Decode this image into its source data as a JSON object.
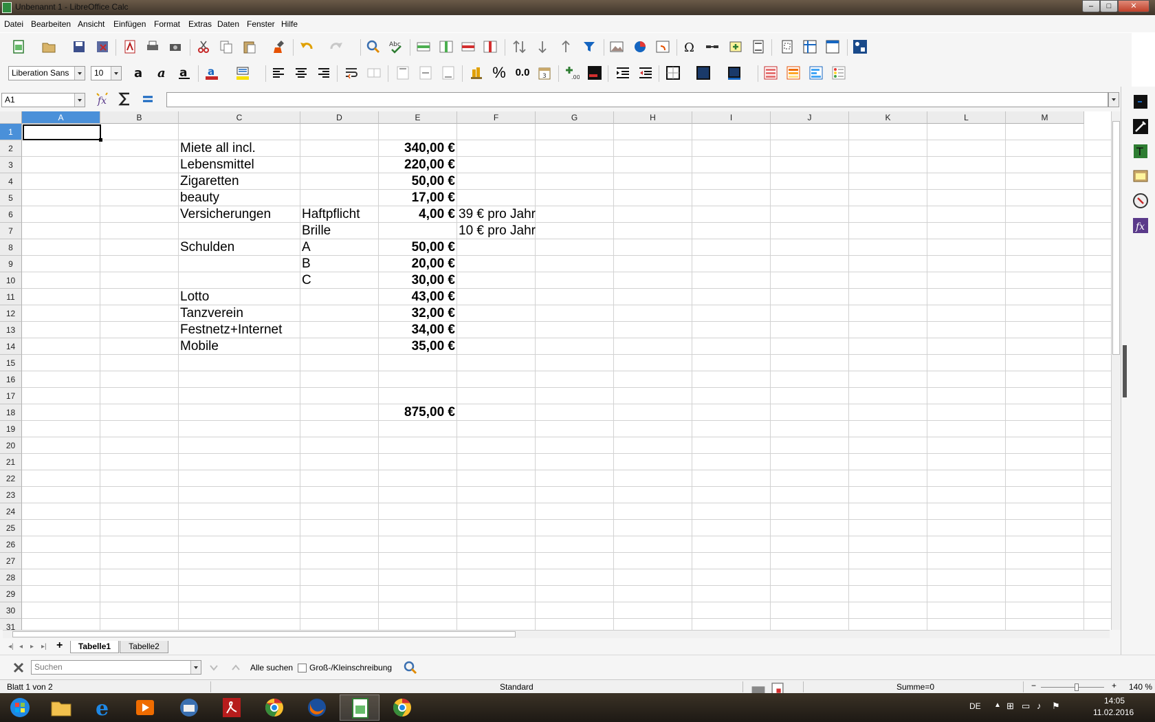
{
  "window": {
    "title": "Unbenannt 1 - LibreOffice Calc",
    "btn_min": "–",
    "btn_max": "□",
    "btn_close": "✕"
  },
  "menu": [
    "Datei",
    "Bearbeiten",
    "Ansicht",
    "Einfügen",
    "Format",
    "Extras",
    "Daten",
    "Fenster",
    "Hilfe"
  ],
  "format_toolbar": {
    "font_name": "Liberation Sans",
    "font_size": "10",
    "percent_label": "%",
    "decimal_label": "0.0"
  },
  "formula_bar": {
    "name_box": "A1",
    "formula": ""
  },
  "columns": [
    "A",
    "B",
    "C",
    "D",
    "E",
    "F",
    "G",
    "H",
    "I",
    "J",
    "K",
    "L",
    "M"
  ],
  "rows": [
    "1",
    "2",
    "3",
    "4",
    "5",
    "6",
    "7",
    "8",
    "9",
    "10",
    "11",
    "12",
    "13",
    "14",
    "15",
    "16",
    "17",
    "18",
    "19",
    "20",
    "21",
    "22",
    "23",
    "24",
    "25",
    "26",
    "27",
    "28",
    "29",
    "30",
    "31"
  ],
  "cells": {
    "C2": "Miete all incl.",
    "E2": "340,00 €",
    "C3": "Lebensmittel",
    "E3": "220,00 €",
    "C4": "Zigaretten",
    "E4": "50,00 €",
    "C5": "beauty",
    "E5": "17,00 €",
    "C6": "Versicherungen",
    "D6": "Haftpflicht",
    "E6": "4,00 €",
    "F6": "39 € pro Jahr",
    "D7": "Brille",
    "F7": "10 € pro Jahr",
    "C8": "Schulden",
    "D8": "A",
    "E8": "50,00 €",
    "D9": "B",
    "E9": "20,00 €",
    "D10": "C",
    "E10": "30,00 €",
    "C11": "Lotto",
    "E11": "43,00 €",
    "C12": "Tanzverein",
    "E12": "32,00 €",
    "C13": "Festnetz+Internet",
    "E13": "34,00 €",
    "C14": "Mobile",
    "E14": "35,00 €",
    "E18": "875,00 €"
  },
  "sheet_tabs": {
    "add": "+",
    "tabs": [
      "Tabelle1",
      "Tabelle2"
    ],
    "active": "Tabelle1"
  },
  "find_bar": {
    "placeholder": "Suchen",
    "find_all": "Alle suchen",
    "match_case": "Groß-/Kleinschreibung"
  },
  "status_bar": {
    "sheet_info": "Blatt 1 von 2",
    "page_style": "Standard",
    "sum": "Summe=0",
    "zoom": "140 %",
    "zoom_minus": "−",
    "zoom_plus": "+"
  },
  "tray": {
    "language": "DE",
    "time": "14:05",
    "date": "11.02.2016"
  }
}
